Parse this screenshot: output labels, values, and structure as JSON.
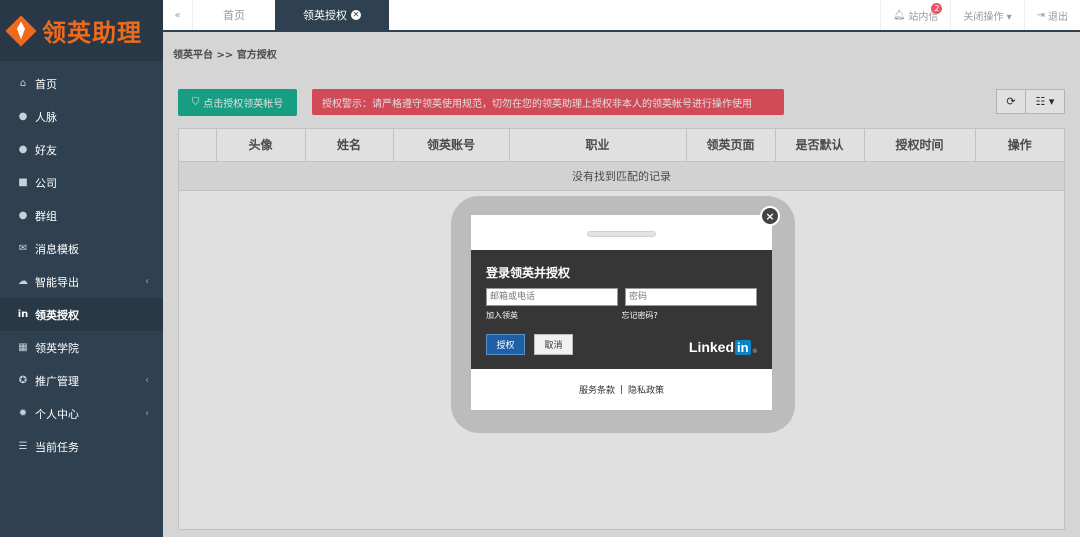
{
  "app": {
    "logo_text": "领英助理",
    "brand_color": "#f06a1c"
  },
  "sidebar": {
    "items": [
      {
        "icon": "home-icon",
        "glyph": "⌂",
        "label": "首页"
      },
      {
        "icon": "user-icon",
        "glyph": "●",
        "label": "人脉"
      },
      {
        "icon": "comments-icon",
        "glyph": "●",
        "label": "好友"
      },
      {
        "icon": "briefcase-icon",
        "glyph": "■",
        "label": "公司"
      },
      {
        "icon": "users-icon",
        "glyph": "●",
        "label": "群组"
      },
      {
        "icon": "envelope-icon",
        "glyph": "✉",
        "label": "消息模板"
      },
      {
        "icon": "cloud-download-icon",
        "glyph": "☁",
        "label": "智能导出",
        "arrow": "‹"
      },
      {
        "icon": "linkedin-icon",
        "glyph": "in",
        "label": "领英授权",
        "active": true
      },
      {
        "icon": "institution-icon",
        "glyph": "▦",
        "label": "领英学院"
      },
      {
        "icon": "compass-icon",
        "glyph": "✪",
        "label": "推广管理",
        "arrow": "‹"
      },
      {
        "icon": "cog-icon",
        "glyph": "✹",
        "label": "个人中心",
        "arrow": "‹"
      },
      {
        "icon": "list-icon",
        "glyph": "☰",
        "label": "当前任务"
      }
    ]
  },
  "topbar": {
    "back_icon": "«",
    "tabs": [
      {
        "label": "首页"
      },
      {
        "label": "领英授权",
        "close": "✕"
      }
    ],
    "messages": {
      "label": "站内信",
      "badge": "2"
    },
    "close_ops": "关闭操作 ▾",
    "logout": "退出"
  },
  "breadcrumb": "领英平台 >> 官方授权",
  "toolbar": {
    "auth_button": "点击授权领英帐号",
    "warning": "授权警示：请严格遵守领英使用规范，切勿在您的领英助理上授权非本人的领英帐号进行操作使用",
    "refresh_icon": "⟳",
    "columns_icon": "☷ ▾"
  },
  "table": {
    "columns": [
      "",
      "头像",
      "姓名",
      "领英账号",
      "职业",
      "领英页面",
      "是否默认",
      "授权时间",
      "操作"
    ],
    "empty_text": "没有找到匹配的记录"
  },
  "dialog": {
    "title": "登录领英并授权",
    "email_placeholder": "邮箱或电话",
    "password_placeholder": "密码",
    "join_link": "加入领英",
    "forgot_link": "忘记密码?",
    "authorize_button": "授权",
    "cancel_button": "取消",
    "logo_word": "Linked",
    "logo_in": "in",
    "logo_reg": "®",
    "terms": "服务条款",
    "separator": "|",
    "privacy": "隐私政策",
    "close": "×"
  }
}
